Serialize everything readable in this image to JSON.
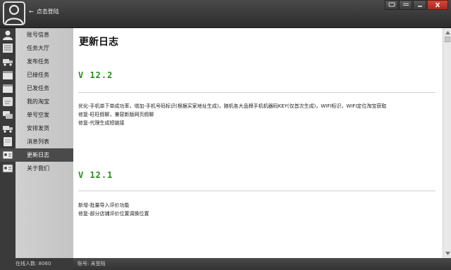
{
  "header": {
    "login_label": "点击登陆"
  },
  "sidebar": {
    "items": [
      {
        "label": "账号信息",
        "icon": "user-icon"
      },
      {
        "label": "任务大厅",
        "icon": "list-icon"
      },
      {
        "label": "发布任务",
        "icon": "truck-icon"
      },
      {
        "label": "已接任务",
        "icon": "calendar-icon"
      },
      {
        "label": "已发任务",
        "icon": "calendar-icon"
      },
      {
        "label": "我的淘宝",
        "icon": "shop-icon"
      },
      {
        "label": "单号空发",
        "icon": "chat-icon"
      },
      {
        "label": "安排发货",
        "icon": "truck-icon"
      },
      {
        "label": "消息列表",
        "icon": "message-icon"
      },
      {
        "label": "更新日志",
        "icon": "id-card-icon",
        "active": true
      },
      {
        "label": "关于我们",
        "icon": "id-card-icon"
      }
    ]
  },
  "main": {
    "title": "更新日志",
    "releases": [
      {
        "version": "V 12.2",
        "notes": [
          "优化-手机单下单成功率，增加-手机号码标识(根据买家地址生成)，随机各大品牌手机机器码KEY(仅首次生成)，WIFI标识，WIFI定位淘宝获取",
          "修复-旺旺假聊，兼容新版网页假聊",
          "修复-代理生成短链接"
        ]
      },
      {
        "version": "V 12.1",
        "notes": [
          "新增-批量导入评价功能",
          "修复-部分店铺评价位置调换位置"
        ]
      }
    ]
  },
  "status": {
    "online": "在线人数: 8060",
    "account": "账号: 未登陆"
  },
  "colors": {
    "version": "#2b8a1f",
    "close": "#c0392b"
  }
}
